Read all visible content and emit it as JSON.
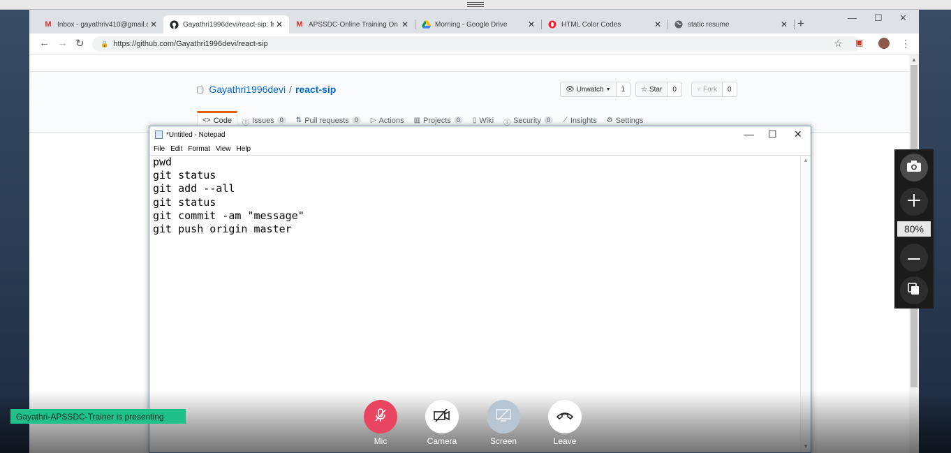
{
  "browser": {
    "tabs": [
      {
        "title": "Inbox - gayathriv410@gmail.c",
        "icon": "gmail-icon"
      },
      {
        "title": "Gayathri1996devi/react-sip: fr",
        "icon": "github-icon"
      },
      {
        "title": "APSSDC-Online Training On W",
        "icon": "gmail-icon"
      },
      {
        "title": "Morning - Google Drive",
        "icon": "drive-icon"
      },
      {
        "title": "HTML Color Codes",
        "icon": "opera-icon"
      },
      {
        "title": "static resume",
        "icon": "globe-icon"
      }
    ],
    "url": "https://github.com/Gayathri1996devi/react-sip"
  },
  "github": {
    "owner": "Gayathri1996devi",
    "separator": "/",
    "repo": "react-sip",
    "unwatch_label": "Unwatch",
    "unwatch_count": "1",
    "star_label": "Star",
    "star_count": "0",
    "fork_label": "Fork",
    "fork_count": "0",
    "tabs": [
      {
        "label": "Code",
        "count": ""
      },
      {
        "label": "Issues",
        "count": "0"
      },
      {
        "label": "Pull requests",
        "count": "0"
      },
      {
        "label": "Actions",
        "count": ""
      },
      {
        "label": "Projects",
        "count": "0"
      },
      {
        "label": "Wiki",
        "count": ""
      },
      {
        "label": "Security",
        "count": "0"
      },
      {
        "label": "Insights",
        "count": ""
      },
      {
        "label": "Settings",
        "count": ""
      }
    ]
  },
  "notepad": {
    "title": "*Untitled - Notepad",
    "menu": [
      "File",
      "Edit",
      "Format",
      "View",
      "Help"
    ],
    "content": "pwd\ngit status\ngit add --all\ngit status\ngit commit -am \"message\"\ngit push origin master"
  },
  "meeting": {
    "presenting": "Gayathri-APSSDC-Trainer is presenting",
    "mic": "Mic",
    "camera": "Camera",
    "screen": "Screen",
    "leave": "Leave",
    "mic_color": "#ea4560"
  },
  "zoom": {
    "level": "80%"
  }
}
